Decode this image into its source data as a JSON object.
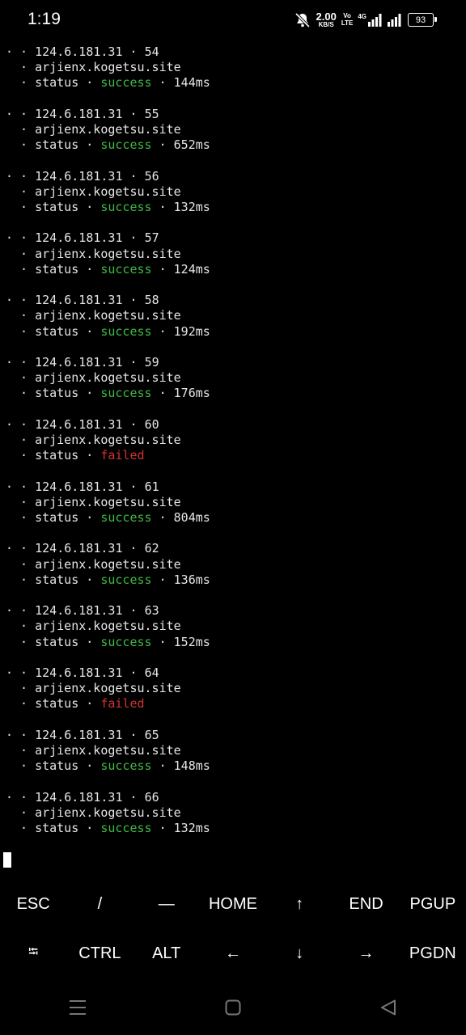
{
  "status_bar": {
    "time": "1:19",
    "net_speed_value": "2.00",
    "net_speed_unit": "KB/S",
    "volte_top": "Vo",
    "volte_bottom": "LTE",
    "network_type": "4G",
    "battery": "93",
    "icons": [
      "mute-icon",
      "signal-icon",
      "signal-icon",
      "battery-icon"
    ]
  },
  "terminal": {
    "entries": [
      {
        "ip": "124.6.181.31",
        "seq": "54",
        "host": "arjienx.kogetsu.site",
        "status_label": "status",
        "status": "success",
        "ok": true,
        "latency": "144ms"
      },
      {
        "ip": "124.6.181.31",
        "seq": "55",
        "host": "arjienx.kogetsu.site",
        "status_label": "status",
        "status": "success",
        "ok": true,
        "latency": "652ms"
      },
      {
        "ip": "124.6.181.31",
        "seq": "56",
        "host": "arjienx.kogetsu.site",
        "status_label": "status",
        "status": "success",
        "ok": true,
        "latency": "132ms"
      },
      {
        "ip": "124.6.181.31",
        "seq": "57",
        "host": "arjienx.kogetsu.site",
        "status_label": "status",
        "status": "success",
        "ok": true,
        "latency": "124ms"
      },
      {
        "ip": "124.6.181.31",
        "seq": "58",
        "host": "arjienx.kogetsu.site",
        "status_label": "status",
        "status": "success",
        "ok": true,
        "latency": "192ms"
      },
      {
        "ip": "124.6.181.31",
        "seq": "59",
        "host": "arjienx.kogetsu.site",
        "status_label": "status",
        "status": "success",
        "ok": true,
        "latency": "176ms"
      },
      {
        "ip": "124.6.181.31",
        "seq": "60",
        "host": "arjienx.kogetsu.site",
        "status_label": "status",
        "status": "failed",
        "ok": false,
        "latency": ""
      },
      {
        "ip": "124.6.181.31",
        "seq": "61",
        "host": "arjienx.kogetsu.site",
        "status_label": "status",
        "status": "success",
        "ok": true,
        "latency": "804ms"
      },
      {
        "ip": "124.6.181.31",
        "seq": "62",
        "host": "arjienx.kogetsu.site",
        "status_label": "status",
        "status": "success",
        "ok": true,
        "latency": "136ms"
      },
      {
        "ip": "124.6.181.31",
        "seq": "63",
        "host": "arjienx.kogetsu.site",
        "status_label": "status",
        "status": "success",
        "ok": true,
        "latency": "152ms"
      },
      {
        "ip": "124.6.181.31",
        "seq": "64",
        "host": "arjienx.kogetsu.site",
        "status_label": "status",
        "status": "failed",
        "ok": false,
        "latency": ""
      },
      {
        "ip": "124.6.181.31",
        "seq": "65",
        "host": "arjienx.kogetsu.site",
        "status_label": "status",
        "status": "success",
        "ok": true,
        "latency": "148ms"
      },
      {
        "ip": "124.6.181.31",
        "seq": "66",
        "host": "arjienx.kogetsu.site",
        "status_label": "status",
        "status": "success",
        "ok": true,
        "latency": "132ms"
      }
    ],
    "colors": {
      "success": "#3fb944",
      "failed": "#d23232",
      "text": "#e6e6e6"
    }
  },
  "extra_keys": {
    "row1": [
      {
        "name": "key-esc",
        "label": "ESC"
      },
      {
        "name": "key-slash",
        "label": "/"
      },
      {
        "name": "key-dash",
        "label": "—"
      },
      {
        "name": "key-home",
        "label": "HOME"
      },
      {
        "name": "key-up",
        "label": "↑"
      },
      {
        "name": "key-end",
        "label": "END"
      },
      {
        "name": "key-pgup",
        "label": "PGUP"
      }
    ],
    "row2": [
      {
        "name": "key-tab",
        "label": "⭾"
      },
      {
        "name": "key-ctrl",
        "label": "CTRL"
      },
      {
        "name": "key-alt",
        "label": "ALT"
      },
      {
        "name": "key-left",
        "label": "←"
      },
      {
        "name": "key-down",
        "label": "↓"
      },
      {
        "name": "key-right",
        "label": "→"
      },
      {
        "name": "key-pgdn",
        "label": "PGDN"
      }
    ]
  },
  "nav_bar": {
    "buttons": [
      "recents-icon",
      "home-icon",
      "back-icon"
    ]
  }
}
